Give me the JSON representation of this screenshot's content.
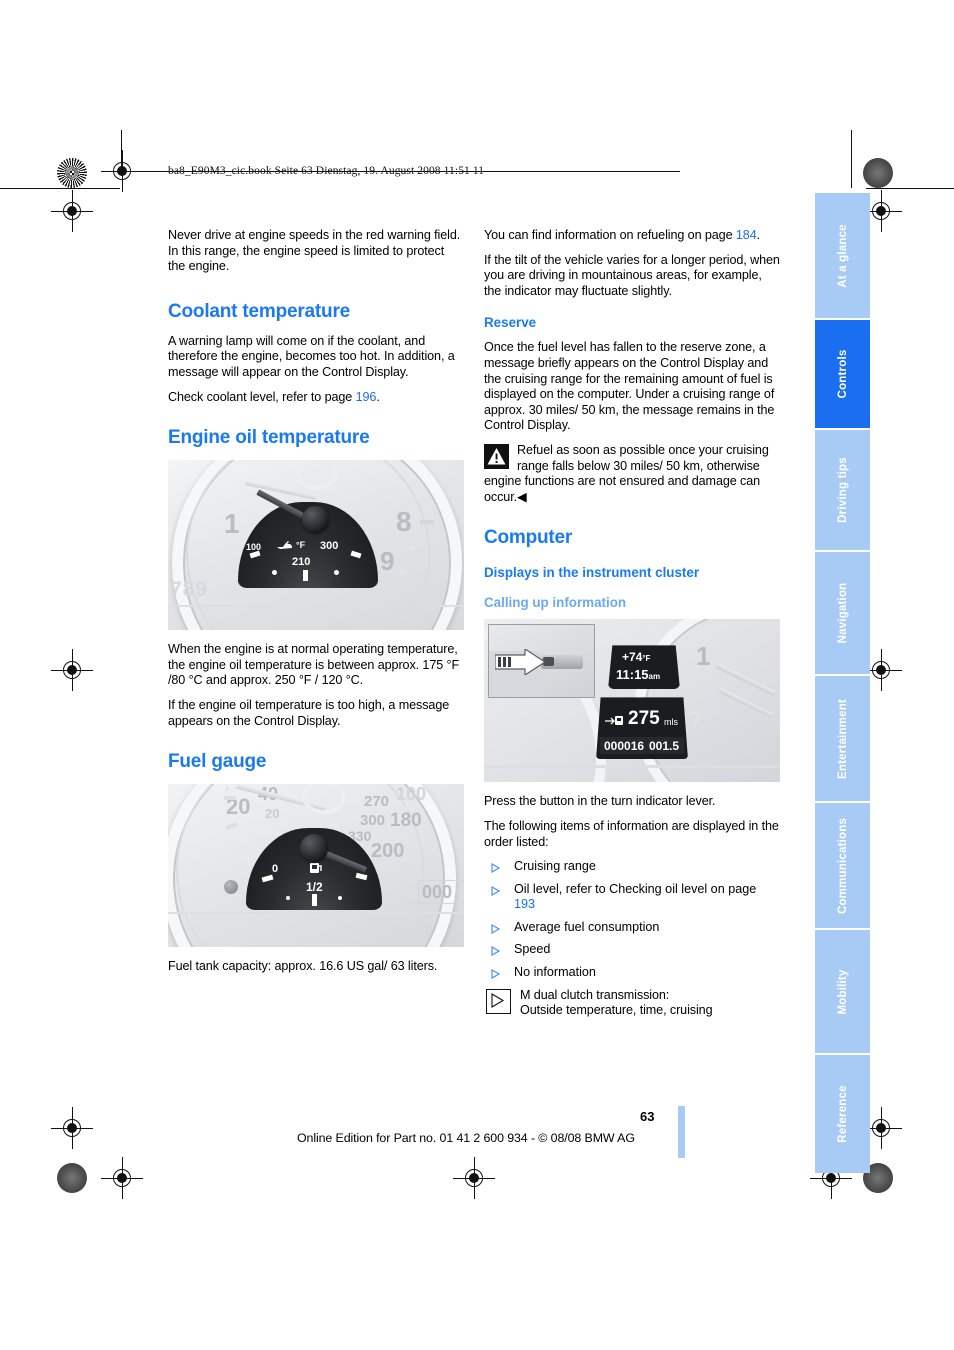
{
  "meta": {
    "file_header": "ba8_E90M3_cic.book  Seite 63  Dienstag, 19. August 2008  11:51 11",
    "page_number": "63",
    "footer": "Online Edition for Part no. 01 41 2 600 934 - © 08/08 BMW AG"
  },
  "left_column": {
    "intro_paragraph": "Never drive at engine speeds in the red warning field. In this range, the engine speed is limited to protect the engine.",
    "coolant": {
      "heading": "Coolant temperature",
      "p1": "A warning lamp will come on if the coolant, and therefore the engine, becomes too hot. In addition, a message will appear on the Control Display.",
      "p2_prefix": "Check coolant level, refer to page ",
      "p2_link": "196",
      "p2_suffix": "."
    },
    "engine_oil": {
      "heading": "Engine oil temperature",
      "figure": {
        "name": "engine-oil-temperature-gauge",
        "unit_label": "°F",
        "mid_value": "210",
        "max_value": "300",
        "min_value": "100",
        "tach_numbers": [
          "1",
          "8",
          "9"
        ],
        "odometer_fragment": "789"
      },
      "p1": "When the engine is at normal operating temperature, the engine oil temperature is between approx. 175 °F /80 °C and approx. 250 °F / 120 °C.",
      "p2": "If the engine oil temperature is too high, a message appears on the Control Display."
    },
    "fuel_gauge": {
      "heading": "Fuel gauge",
      "figure": {
        "name": "fuel-gauge",
        "empty_label": "0",
        "half_label": "1/2",
        "speedo_numbers": [
          "20",
          "40",
          "20",
          "270",
          "100",
          "300",
          "180",
          "330",
          "200"
        ],
        "odometer_fragment": "000"
      },
      "p1": "Fuel tank capacity: approx. 16.6 US gal/ 63 liters."
    }
  },
  "right_column": {
    "refuel_info": {
      "prefix": "You can find information on refueling on page ",
      "link": "184",
      "suffix": "."
    },
    "tilt_paragraph": "If the tilt of the vehicle varies for a longer period, when you are driving in mountainous areas, for example, the indicator may fluctuate slightly.",
    "reserve": {
      "heading": "Reserve",
      "p1": "Once the fuel level has fallen to the reserve zone, a message briefly appears on the Control Display and the cruising range for the remaining amount of fuel is displayed on the computer. Under a cruising range of approx. 30 miles/ 50 km, the message remains in the Control Display.",
      "warning": "Refuel as soon as possible once your cruising range falls below 30 miles/ 50 km, otherwise engine functions are not ensured and damage can occur.◀"
    },
    "computer": {
      "heading": "Computer",
      "sub_heading": "Displays in the instrument cluster",
      "sub_sub_heading": "Calling up information",
      "figure": {
        "name": "instrument-cluster-display",
        "outside_temp": "+74",
        "temp_unit": "°F",
        "clock": "11:15",
        "clock_suffix": "am",
        "range_value": "275",
        "range_unit": "mls",
        "odometer": "000016",
        "trip": "001.5",
        "tach_number": "1",
        "inset_caption": "turn-indicator-lever-button"
      },
      "p1": "Press the button in the turn indicator lever.",
      "p2": "The following items of information are displayed in the order listed:",
      "items": [
        {
          "text": "Cruising range"
        },
        {
          "text": "Oil level, refer to Checking oil level on page ",
          "link": "193"
        },
        {
          "text": "Average fuel consumption"
        },
        {
          "text": "Speed"
        },
        {
          "text": "No information"
        }
      ],
      "dct_note_line1": "M dual clutch transmission:",
      "dct_note_line2": "Outside temperature, time, cruising"
    }
  },
  "sidebar": {
    "tabs": [
      {
        "label": "At a glance",
        "active": false
      },
      {
        "label": "Controls",
        "active": true
      },
      {
        "label": "Driving tips",
        "active": false
      },
      {
        "label": "Navigation",
        "active": false
      },
      {
        "label": "Entertainment",
        "active": false
      },
      {
        "label": "Communications",
        "active": false
      },
      {
        "label": "Mobility",
        "active": false
      },
      {
        "label": "Reference",
        "active": false
      }
    ],
    "colors": {
      "inactive": "#a8cbf5",
      "active": "#1a6ef0",
      "text": "#ffffff"
    }
  },
  "colors": {
    "heading_blue": "#1a7af0",
    "light_heading_blue": "#6ea8f2",
    "link_blue": "#1a6cf0",
    "text_black": "#000000"
  }
}
